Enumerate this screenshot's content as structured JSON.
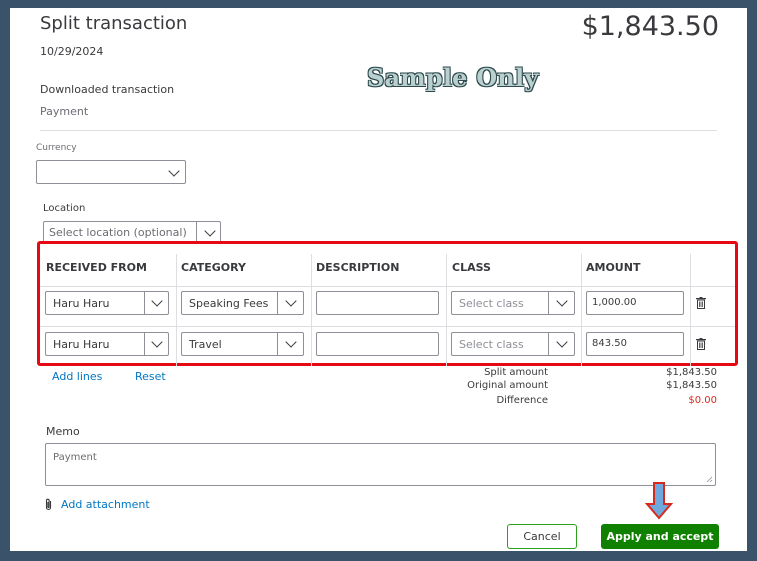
{
  "header": {
    "title": "Split transaction",
    "total": "$1,843.50",
    "date": "10/29/2024",
    "downloaded_label": "Downloaded transaction",
    "downloaded_value": "Payment",
    "watermark": "Sample Only"
  },
  "currency": {
    "label": "Currency",
    "value": ""
  },
  "location": {
    "label": "Location",
    "placeholder": "Select location (optional)"
  },
  "table": {
    "headers": [
      "RECEIVED FROM",
      "CATEGORY",
      "DESCRIPTION",
      "CLASS",
      "AMOUNT"
    ],
    "rows": [
      {
        "received_from": "Haru Haru",
        "category": "Speaking Fees",
        "description": "",
        "class": "Select class",
        "amount": "1,000.00"
      },
      {
        "received_from": "Haru Haru",
        "category": "Travel",
        "description": "",
        "class": "Select class",
        "amount": "843.50"
      }
    ]
  },
  "actions": {
    "add_lines": "Add lines",
    "reset": "Reset"
  },
  "summary": {
    "split_amount_label": "Split amount",
    "split_amount_value": "$1,843.50",
    "original_amount_label": "Original amount",
    "original_amount_value": "$1,843.50",
    "difference_label": "Difference",
    "difference_value": "$0.00"
  },
  "memo": {
    "label": "Memo",
    "value": "Payment"
  },
  "attachment": {
    "label": "Add attachment"
  },
  "footer": {
    "cancel_label": "Cancel",
    "apply_label": "Apply and accept"
  },
  "colors": {
    "primary_green": "#108000",
    "link_blue": "#0077c5",
    "highlight_red": "#e50914",
    "difference_red": "#d52b1e"
  }
}
